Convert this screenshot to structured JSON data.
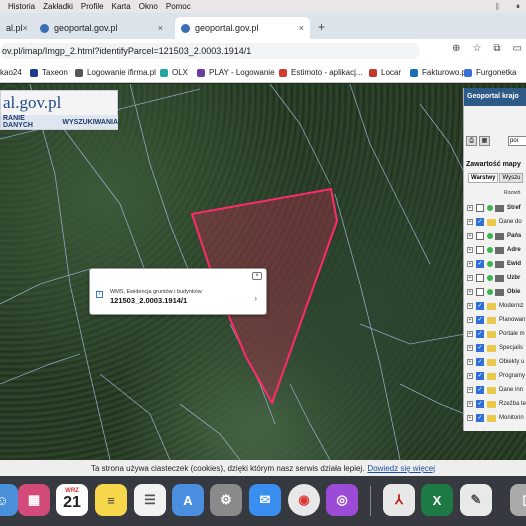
{
  "menubar": {
    "items": [
      "Historia",
      "Zakładki",
      "Profile",
      "Karta",
      "Okno",
      "Pomoc"
    ]
  },
  "tabs": [
    {
      "label": "al.pl",
      "active": false
    },
    {
      "label": "geoportal.gov.pl",
      "active": false
    },
    {
      "label": "geoportal.gov.pl",
      "active": true
    }
  ],
  "address": {
    "url": "ov.pl/imap/Imgp_2.html?identifyParcel=121503_2.0003.1914/1"
  },
  "bookmarks": [
    {
      "label": "kao24",
      "color": "#888888"
    },
    {
      "label": "Taxeon",
      "color": "#1a3c8a"
    },
    {
      "label": "Logowanie ifirma.pl",
      "color": "#555555"
    },
    {
      "label": "OLX",
      "color": "#23a6a0"
    },
    {
      "label": "PLAY - Logowanie",
      "color": "#6a3ea0"
    },
    {
      "label": "Estimoto - aplikacj...",
      "color": "#d33a2c"
    },
    {
      "label": "Locar",
      "color": "#c0392b"
    },
    {
      "label": "Fakturowo.pl",
      "color": "#1c6fb5"
    },
    {
      "label": "Furgonetka",
      "color": "#3b6ed6"
    }
  ],
  "site": {
    "logo_text": "al.gov.pl",
    "nav": [
      "RANIE DANYCH",
      "WYSZUKIWANIA"
    ]
  },
  "popup": {
    "title": "WMS, Ewidencja gruntów i budynków",
    "value": "121503_2.0003.1914/1"
  },
  "panel": {
    "header": "Geoportal krajo",
    "search_value": "poi",
    "title": "Zawartość mapy",
    "tabs": [
      "Warstwy",
      "Wyszu"
    ],
    "expand_label": "Rozwiń",
    "layers": [
      {
        "label": "Stref",
        "checked": false,
        "bold": true,
        "kind": "wms"
      },
      {
        "label": "Dane do",
        "checked": true,
        "bold": false,
        "kind": "folder"
      },
      {
        "label": "Pańs",
        "checked": false,
        "bold": true,
        "kind": "wms"
      },
      {
        "label": "Adre",
        "checked": false,
        "bold": true,
        "kind": "wms"
      },
      {
        "label": "Ewid",
        "checked": true,
        "bold": true,
        "kind": "wms"
      },
      {
        "label": "Uzbr",
        "checked": false,
        "bold": true,
        "kind": "wms"
      },
      {
        "label": "Obie",
        "checked": false,
        "bold": true,
        "kind": "wms"
      },
      {
        "label": "Moderniz",
        "checked": true,
        "bold": false,
        "kind": "folder"
      },
      {
        "label": "Planowan",
        "checked": true,
        "bold": false,
        "kind": "folder"
      },
      {
        "label": "Portale m",
        "checked": true,
        "bold": false,
        "kind": "folder"
      },
      {
        "label": "Specjalis",
        "checked": true,
        "bold": false,
        "kind": "folder"
      },
      {
        "label": "Obiekty u",
        "checked": true,
        "bold": false,
        "kind": "folder"
      },
      {
        "label": "Programy",
        "checked": true,
        "bold": false,
        "kind": "folder"
      },
      {
        "label": "Dane inn",
        "checked": true,
        "bold": false,
        "kind": "folder"
      },
      {
        "label": "Rzeźba te",
        "checked": true,
        "bold": false,
        "kind": "folder"
      },
      {
        "label": "Monitorin",
        "checked": true,
        "bold": false,
        "kind": "folder"
      }
    ]
  },
  "cookie": {
    "text": "Ta strona używa ciasteczek (cookies), dzięki którym nasz serwis działa lepiej.",
    "link": "Dowiedz się więcej"
  },
  "dock": {
    "calendar_month": "WRZ",
    "calendar_day": "21"
  },
  "colors": {
    "parcel_stroke": "#ff2a6d",
    "parcel_fill": "rgba(200,40,80,0.35)",
    "panel_header": "#2e5a86"
  }
}
